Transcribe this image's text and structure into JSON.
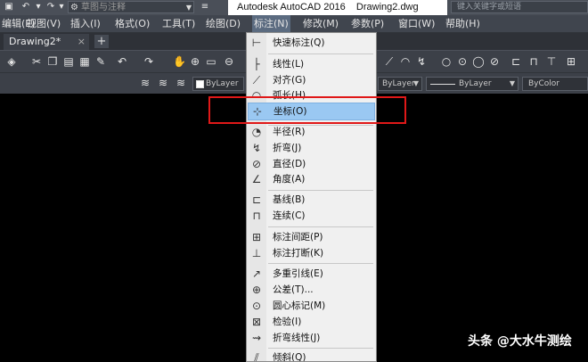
{
  "titlebar": {
    "quick_access_icons": [
      "open-icon",
      "undo-icon",
      "redo-icon"
    ],
    "workspace_value": "草图与注释",
    "app_title": "Autodesk AutoCAD 2016    Drawing2.dwg",
    "search_placeholder": "键入关键字或短语"
  },
  "menubar": {
    "items": [
      {
        "label": "编辑(E)"
      },
      {
        "label": "视图(V)"
      },
      {
        "label": "插入(I)"
      },
      {
        "label": "格式(O)"
      },
      {
        "label": "工具(T)"
      },
      {
        "label": "绘图(D)"
      },
      {
        "label": "标注(N)"
      },
      {
        "label": "修改(M)"
      },
      {
        "label": "参数(P)"
      },
      {
        "label": "窗口(W)"
      },
      {
        "label": "帮助(H)"
      }
    ]
  },
  "tabs": {
    "active_label": "Drawing2*",
    "close_glyph": "×",
    "new_glyph": "+"
  },
  "properties": {
    "layer_value": "ByLayer",
    "linetype_value": "ByLayer",
    "lineweight_value": "ByLayer",
    "plotstyle_value": "ByColor"
  },
  "dimension_menu": {
    "items": [
      {
        "label": "快速标注(Q)",
        "icon": "quick-dimension-icon",
        "glyph": "⊢"
      },
      {
        "label": "线性(L)",
        "icon": "linear-icon",
        "glyph": "├"
      },
      {
        "label": "对齐(G)",
        "icon": "aligned-icon",
        "glyph": "⟋"
      },
      {
        "label": "弧长(H)",
        "icon": "arc-length-icon",
        "glyph": "◠"
      },
      {
        "label": "坐标(O)",
        "icon": "ordinate-icon",
        "glyph": "⊹"
      },
      {
        "label": "半径(R)",
        "icon": "radius-icon",
        "glyph": "◔"
      },
      {
        "label": "折弯(J)",
        "icon": "jogged-icon",
        "glyph": "↯"
      },
      {
        "label": "直径(D)",
        "icon": "diameter-icon",
        "glyph": "⊘"
      },
      {
        "label": "角度(A)",
        "icon": "angular-icon",
        "glyph": "∠"
      },
      {
        "label": "基线(B)",
        "icon": "baseline-icon",
        "glyph": "⊏"
      },
      {
        "label": "连续(C)",
        "icon": "continue-icon",
        "glyph": "⊓"
      },
      {
        "label": "标注间距(P)",
        "icon": "dim-space-icon",
        "glyph": "⊞"
      },
      {
        "label": "标注打断(K)",
        "icon": "dim-break-icon",
        "glyph": "⊥"
      },
      {
        "label": "多重引线(E)",
        "icon": "multileader-icon",
        "glyph": "↗"
      },
      {
        "label": "公差(T)...",
        "icon": "tolerance-icon",
        "glyph": "⊕"
      },
      {
        "label": "圆心标记(M)",
        "icon": "center-mark-icon",
        "glyph": "⊙"
      },
      {
        "label": "检验(I)",
        "icon": "inspection-icon",
        "glyph": "⊠"
      },
      {
        "label": "折弯线性(J)",
        "icon": "jogged-linear-icon",
        "glyph": "⇝"
      },
      {
        "label": "倾斜(Q)",
        "icon": "oblique-icon",
        "glyph": "⫽"
      }
    ],
    "highlighted_index": 4
  },
  "watermark": "头条 @大水牛测绘",
  "colors": {
    "highlight": "#9ac8f2",
    "annotation_box": "#e01818",
    "canvas": "#000000"
  }
}
